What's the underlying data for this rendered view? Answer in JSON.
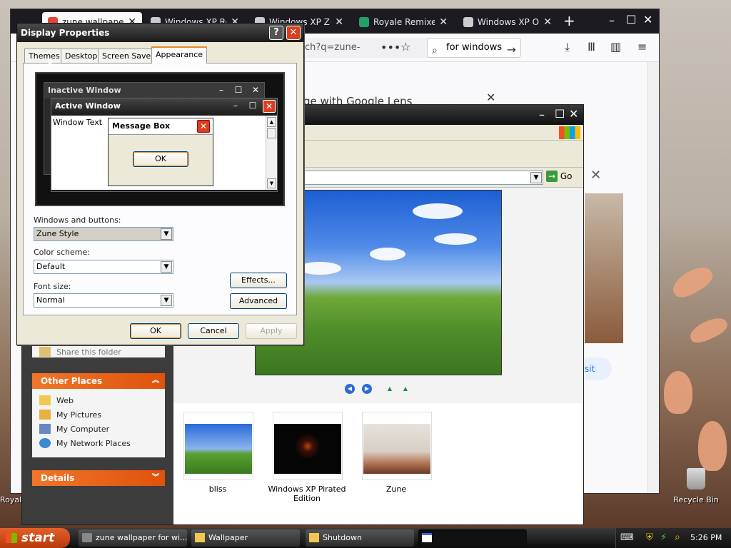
{
  "browser": {
    "tabs": [
      {
        "title": "zune wallpaper fo",
        "fav_color": "#e94235"
      },
      {
        "title": "Windows XP Royale",
        "fav_color": "#cccccc"
      },
      {
        "title": "Windows XP Zune",
        "fav_color": "#cccccc"
      },
      {
        "title": "Royale Remixed (",
        "fav_color": "#23a06a"
      },
      {
        "title": "Windows XP Offi",
        "fav_color": "#cccccc"
      }
    ],
    "url_text": "ch?q=zune-",
    "search_text": "for windows",
    "lens_text": "ge with Google Lens",
    "visit_text": "sit"
  },
  "explorer": {
    "go_label": "Go",
    "other_places_title": "Other Places",
    "share_text": "Share this folder",
    "places": [
      "Web",
      "My Pictures",
      "My Computer",
      "My Network Places"
    ],
    "details_title": "Details",
    "thumbnails": [
      {
        "caption": "bliss"
      },
      {
        "caption": "Windows XP Pirated Edition"
      },
      {
        "caption": "Zune"
      }
    ]
  },
  "dialog": {
    "title": "Display Properties",
    "help": "?",
    "close": "✕",
    "tabs": [
      "Themes",
      "Desktop",
      "Screen Saver",
      "Appearance"
    ],
    "active_tab": "Appearance",
    "preview": {
      "inactive": "Inactive Window",
      "active": "Active Window",
      "window_text": "Window Text",
      "message_box": "Message Box",
      "ok": "OK"
    },
    "windows_buttons_label": "Windows and buttons:",
    "windows_buttons_value": "Zune Style",
    "color_scheme_label": "Color scheme:",
    "color_scheme_value": "Default",
    "font_size_label": "Font size:",
    "font_size_value": "Normal",
    "effects_label": "Effects...",
    "advanced_label": "Advanced",
    "ok_label": "OK",
    "cancel_label": "Cancel",
    "apply_label": "Apply"
  },
  "desktop": {
    "recycle_bin": "Recycle Bin",
    "royal_label": "Royal"
  },
  "taskbar": {
    "start_label": "start",
    "buttons": [
      "zune wallpaper for wi...",
      "Wallpaper",
      "Shutdown"
    ],
    "clock": "5:26 PM"
  },
  "colors": {
    "xp_orange": "#e0520c",
    "close_red": "#d9401f",
    "tab_active_border": "#e68b2c"
  }
}
